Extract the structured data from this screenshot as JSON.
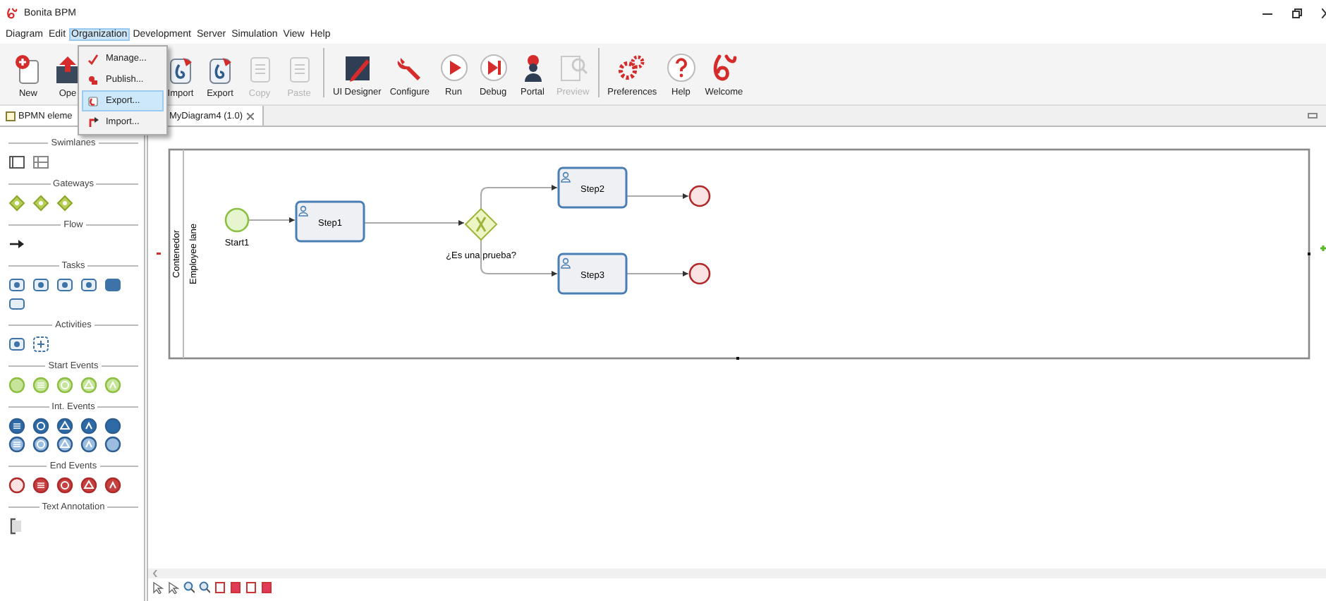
{
  "window": {
    "title": "Bonita BPM"
  },
  "menu": [
    {
      "label": "Diagram",
      "selected": false
    },
    {
      "label": "Edit",
      "selected": false
    },
    {
      "label": "Organization",
      "selected": true
    },
    {
      "label": "Development",
      "selected": false
    },
    {
      "label": "Server",
      "selected": false
    },
    {
      "label": "Simulation",
      "selected": false
    },
    {
      "label": "View",
      "selected": false
    },
    {
      "label": "Help",
      "selected": false
    }
  ],
  "open_menu": {
    "items": [
      {
        "label": "Manage...",
        "kind": "manage",
        "selected": false
      },
      {
        "label": "Publish...",
        "kind": "publish",
        "selected": false
      },
      {
        "label": "Export...",
        "kind": "export",
        "selected": true
      },
      {
        "label": "Import...",
        "kind": "import",
        "selected": false
      }
    ]
  },
  "toolbar": {
    "groups": [
      [
        {
          "label": "New",
          "kind": "new",
          "disabled": false
        },
        {
          "label": "Ope",
          "kind": "open",
          "disabled": false
        }
      ],
      [
        {
          "label": "Import",
          "kind": "import",
          "disabled": false
        },
        {
          "label": "Export",
          "kind": "export",
          "disabled": false
        },
        {
          "label": "Copy",
          "kind": "copy",
          "disabled": true
        },
        {
          "label": "Paste",
          "kind": "paste",
          "disabled": true
        }
      ],
      [
        {
          "label": "UI Designer",
          "kind": "designer",
          "disabled": false
        },
        {
          "label": "Configure",
          "kind": "configure",
          "disabled": false
        },
        {
          "label": "Run",
          "kind": "run",
          "disabled": false
        },
        {
          "label": "Debug",
          "kind": "debug",
          "disabled": false
        },
        {
          "label": "Portal",
          "kind": "portal",
          "disabled": false
        },
        {
          "label": "Preview",
          "kind": "preview",
          "disabled": true
        }
      ],
      [
        {
          "label": "Preferences",
          "kind": "preferences",
          "disabled": false
        },
        {
          "label": "Help",
          "kind": "help",
          "disabled": false
        },
        {
          "label": "Welcome",
          "kind": "welcome",
          "disabled": false
        }
      ]
    ]
  },
  "tabs": {
    "palette": {
      "label": "BPMN eleme"
    },
    "editor": {
      "label": "MyDiagram4 (1.0)"
    }
  },
  "palette": {
    "sections": [
      {
        "title": "Swimlanes",
        "items": [
          {
            "kind": "pool"
          },
          {
            "kind": "lane"
          }
        ]
      },
      {
        "title": "Gateways",
        "items": [
          {
            "kind": "gateway"
          },
          {
            "kind": "gateway"
          },
          {
            "kind": "gateway"
          }
        ]
      },
      {
        "title": "Flow",
        "items": [
          {
            "kind": "flow"
          }
        ]
      },
      {
        "title": "Tasks",
        "items": [
          {
            "kind": "task"
          },
          {
            "kind": "task"
          },
          {
            "kind": "task"
          },
          {
            "kind": "task"
          },
          {
            "kind": "task"
          },
          {
            "kind": "task"
          }
        ]
      },
      {
        "title": "Activities",
        "items": [
          {
            "kind": "task"
          },
          {
            "kind": "subprocess"
          }
        ]
      },
      {
        "title": "Start Events",
        "items": [
          {
            "kind": "start"
          },
          {
            "kind": "start"
          },
          {
            "kind": "start"
          },
          {
            "kind": "start"
          },
          {
            "kind": "start"
          }
        ]
      },
      {
        "title": "Int. Events",
        "items": [
          {
            "kind": "intermediate"
          },
          {
            "kind": "intermediate"
          },
          {
            "kind": "intermediate"
          },
          {
            "kind": "intermediate"
          },
          {
            "kind": "intermediate"
          },
          {
            "kind": "intermediate"
          },
          {
            "kind": "intermediate"
          },
          {
            "kind": "intermediate"
          },
          {
            "kind": "intermediate"
          },
          {
            "kind": "intermediate"
          }
        ]
      },
      {
        "title": "End Events",
        "items": [
          {
            "kind": "end"
          },
          {
            "kind": "end"
          },
          {
            "kind": "end"
          },
          {
            "kind": "end"
          },
          {
            "kind": "end"
          }
        ]
      },
      {
        "title": "Text Annotation",
        "items": [
          {
            "kind": "annotation"
          }
        ]
      }
    ]
  },
  "diagram": {
    "pool": {
      "label": "Contenedor"
    },
    "lane": {
      "label": "Employee lane"
    },
    "nodes": [
      {
        "kind": "start",
        "label": "Start1"
      },
      {
        "kind": "task",
        "label": "Step1"
      },
      {
        "kind": "gateway",
        "label": "¿Es una prueba?"
      },
      {
        "kind": "task",
        "label": "Step2"
      },
      {
        "kind": "task",
        "label": "Step3"
      },
      {
        "kind": "end"
      },
      {
        "kind": "end"
      }
    ]
  }
}
